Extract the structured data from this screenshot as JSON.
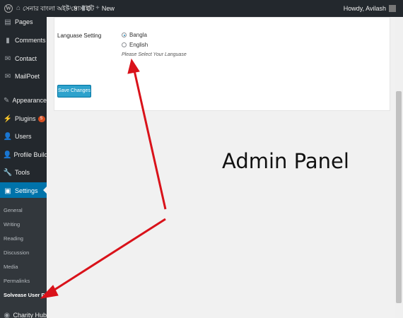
{
  "adminbar": {
    "site_name": "সেনার বাংলা অইট সোসাইটি",
    "updates_count": "9",
    "comments_count": "0",
    "new_label": "New",
    "howdy": "Howdy, Avilash"
  },
  "sidebar": {
    "items": [
      {
        "label": "Pages",
        "icon": "pages-icon"
      },
      {
        "label": "Comments",
        "icon": "comments-icon"
      },
      {
        "label": "Contact",
        "icon": "contact-icon"
      },
      {
        "label": "MailPoet",
        "icon": "mailpoet-icon"
      },
      {
        "label": "Appearance",
        "icon": "appearance-icon"
      },
      {
        "label": "Plugins",
        "icon": "plugins-icon",
        "badge": "5"
      },
      {
        "label": "Users",
        "icon": "users-icon"
      },
      {
        "label": "Profile Builder",
        "icon": "profile-builder-icon"
      },
      {
        "label": "Tools",
        "icon": "tools-icon"
      },
      {
        "label": "Settings",
        "icon": "settings-icon"
      },
      {
        "label": "Charity Hub",
        "icon": "charity-hub-icon"
      }
    ],
    "submenu": [
      "General",
      "Writing",
      "Reading",
      "Discussion",
      "Media",
      "Permalinks",
      "Solvease User Profile"
    ]
  },
  "form": {
    "field_label": "Languase Setting",
    "options": [
      "Bangla",
      "English"
    ],
    "selected": "Bangla",
    "help": "Please Select Your Languase",
    "save_label": "Save Changes"
  },
  "panel_title": "Admin Panel",
  "colors": {
    "sidebar_bg": "#23282d",
    "active_blue": "#0073aa",
    "button_blue": "#2ea2cc",
    "arrow_red": "#d9121a"
  }
}
